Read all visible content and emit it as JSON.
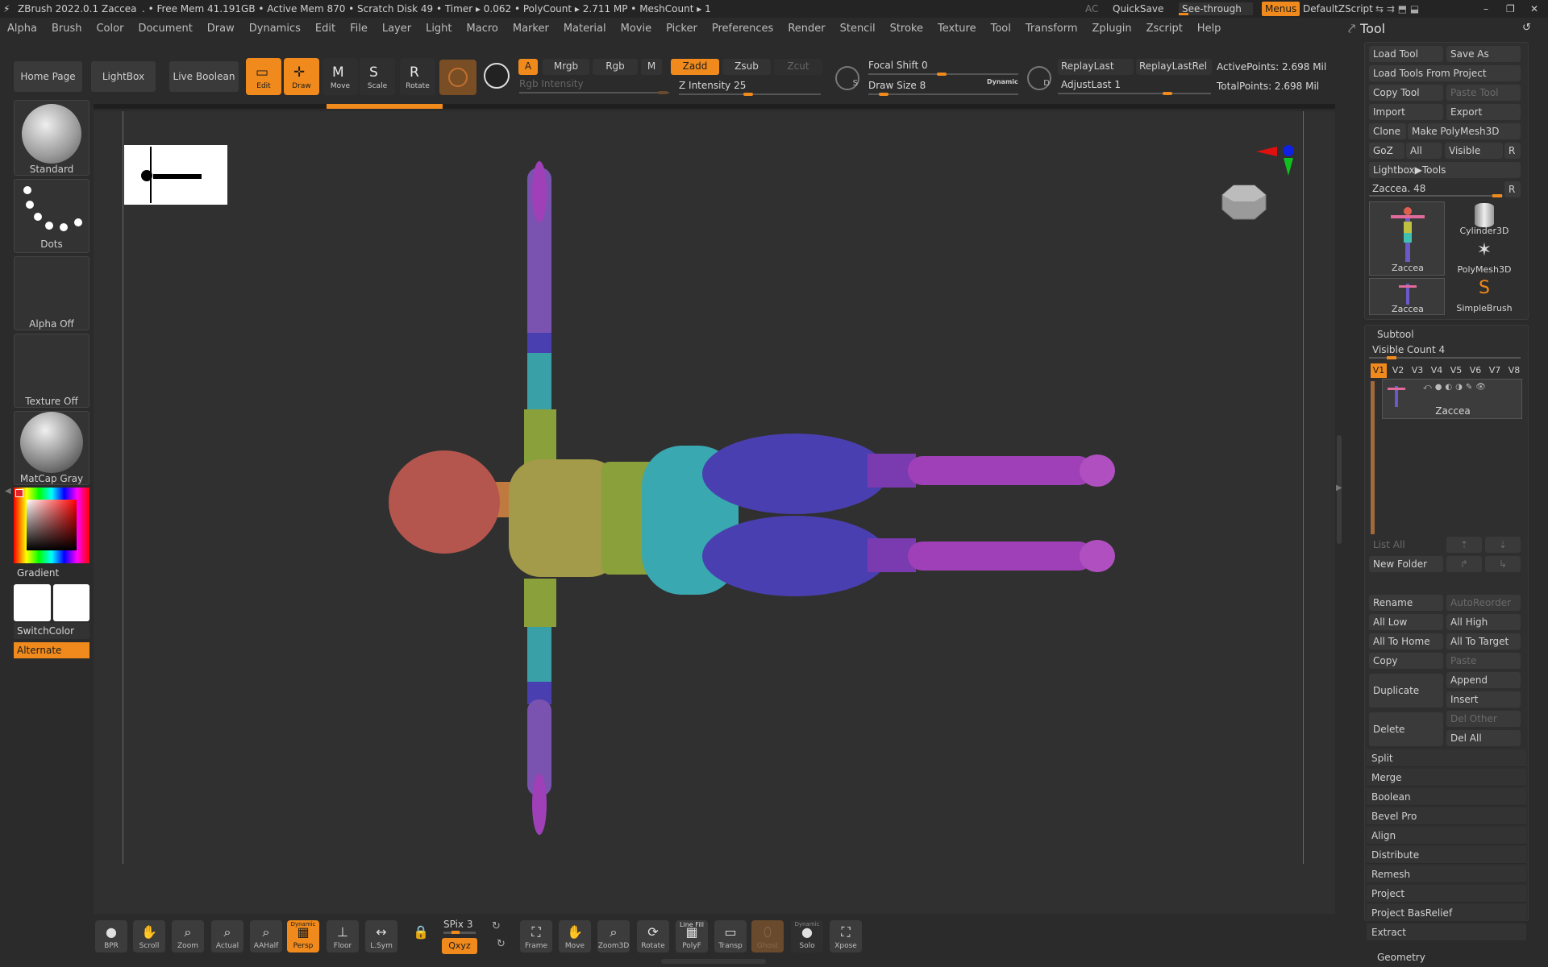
{
  "titlebar": {
    "app": "ZBrush 2022.0.1",
    "doc": "Zaccea",
    "stats": ". • Free Mem 41.191GB • Active Mem 870 • Scratch Disk 49 • Timer ▸ 0.062 • PolyCount ▸ 2.711 MP • MeshCount ▸ 1",
    "ac": "AC",
    "quicksave": "QuickSave",
    "seethrough": "See-through",
    "seethrough_value": "0",
    "menus": "Menus",
    "script": "DefaultZScript"
  },
  "menus": [
    "Alpha",
    "Brush",
    "Color",
    "Document",
    "Draw",
    "Dynamics",
    "Edit",
    "File",
    "Layer",
    "Light",
    "Macro",
    "Marker",
    "Material",
    "Movie",
    "Picker",
    "Preferences",
    "Render",
    "Stencil",
    "Stroke",
    "Texture",
    "Tool",
    "Transform",
    "Zplugin",
    "Zscript",
    "Help"
  ],
  "toolbar": {
    "home": "Home Page",
    "lightbox": "LightBox",
    "liveboolean": "Live Boolean",
    "edit": "Edit",
    "draw": "Draw",
    "move": "Move",
    "scale": "Scale",
    "rotate": "Rotate",
    "a": "A",
    "mrgb": "Mrgb",
    "rgb": "Rgb",
    "m": "M",
    "zadd": "Zadd",
    "zsub": "Zsub",
    "zcut": "Zcut",
    "rgb_intensity": "Rgb Intensity",
    "z_intensity": "Z Intensity 25",
    "focal_shift": "Focal Shift 0",
    "draw_size": "Draw Size 8",
    "dynamic": "Dynamic",
    "replay_last": "ReplayLast",
    "replay_last_rel": "ReplayLastRel",
    "adjust_last": "AdjustLast 1",
    "active_points": "ActivePoints: 2.698 Mil",
    "total_points": "TotalPoints: 2.698 Mil",
    "s": "S",
    "d": "D"
  },
  "left": {
    "standard": "Standard",
    "dots": "Dots",
    "alpha_off": "Alpha Off",
    "texture_off": "Texture Off",
    "matcap": "MatCap Gray",
    "gradient": "Gradient",
    "switchcolor": "SwitchColor",
    "alternate": "Alternate"
  },
  "right": {
    "title": "Tool",
    "load_tool": "Load Tool",
    "save_as": "Save As",
    "load_from_project": "Load Tools From Project",
    "copy_tool": "Copy Tool",
    "paste_tool": "Paste Tool",
    "import": "Import",
    "export": "Export",
    "clone": "Clone",
    "make_polymesh": "Make PolyMesh3D",
    "goz": "GoZ",
    "all": "All",
    "visible": "Visible",
    "r": "R",
    "lightbox_tools": "Lightbox▶Tools",
    "zaccea_slider": "Zaccea. 48",
    "thumbs": [
      "Zaccea",
      "Cylinder3D",
      "PolyMesh3D",
      "Zaccea",
      "SimpleBrush"
    ],
    "subtool": "Subtool",
    "visible_count": "Visible Count 4",
    "vtabs": [
      "V1",
      "V2",
      "V3",
      "V4",
      "V5",
      "V6",
      "V7",
      "V8"
    ],
    "subtool_name": "Zaccea",
    "list_all": "List All",
    "new_folder": "New Folder",
    "rename": "Rename",
    "autoreorder": "AutoReorder",
    "all_low": "All Low",
    "all_high": "All High",
    "all_to_home": "All To Home",
    "all_to_target": "All To Target",
    "copy": "Copy",
    "paste": "Paste",
    "duplicate": "Duplicate",
    "append": "Append",
    "insert": "Insert",
    "delete": "Delete",
    "del_other": "Del Other",
    "del_all": "Del All",
    "rows": [
      "Split",
      "Merge",
      "Boolean",
      "Bevel Pro",
      "Align",
      "Distribute",
      "Remesh",
      "Project",
      "Project BasRelief",
      "Extract"
    ],
    "geometry": "Geometry"
  },
  "bottom": {
    "bpr": "BPR",
    "scroll": "Scroll",
    "zoom": "Zoom",
    "actual": "Actual",
    "aahalf": "AAHalf",
    "dynamic": "Dynamic",
    "persp": "Persp",
    "floor": "Floor",
    "lsym": "L.Sym",
    "spix": "SPix 3",
    "xyz": "Qxyz",
    "frame": "Frame",
    "move": "Move",
    "zoom3d": "Zoom3D",
    "rotate": "Rotate",
    "linefill": "Line Fill",
    "polyf": "PolyF",
    "transp": "Transp",
    "ghost": "Ghost",
    "dynamic2": "Dynamic",
    "solo": "Solo",
    "xpose": "Xpose"
  },
  "colors": {
    "accent": "#f08a1c",
    "head": "#b5564e",
    "torso": "#a39a4a",
    "hips": "#3aa8b0",
    "thigh": "#4a3fb0",
    "calf": "#a040b8",
    "arm_upper": "#7a52b0"
  }
}
